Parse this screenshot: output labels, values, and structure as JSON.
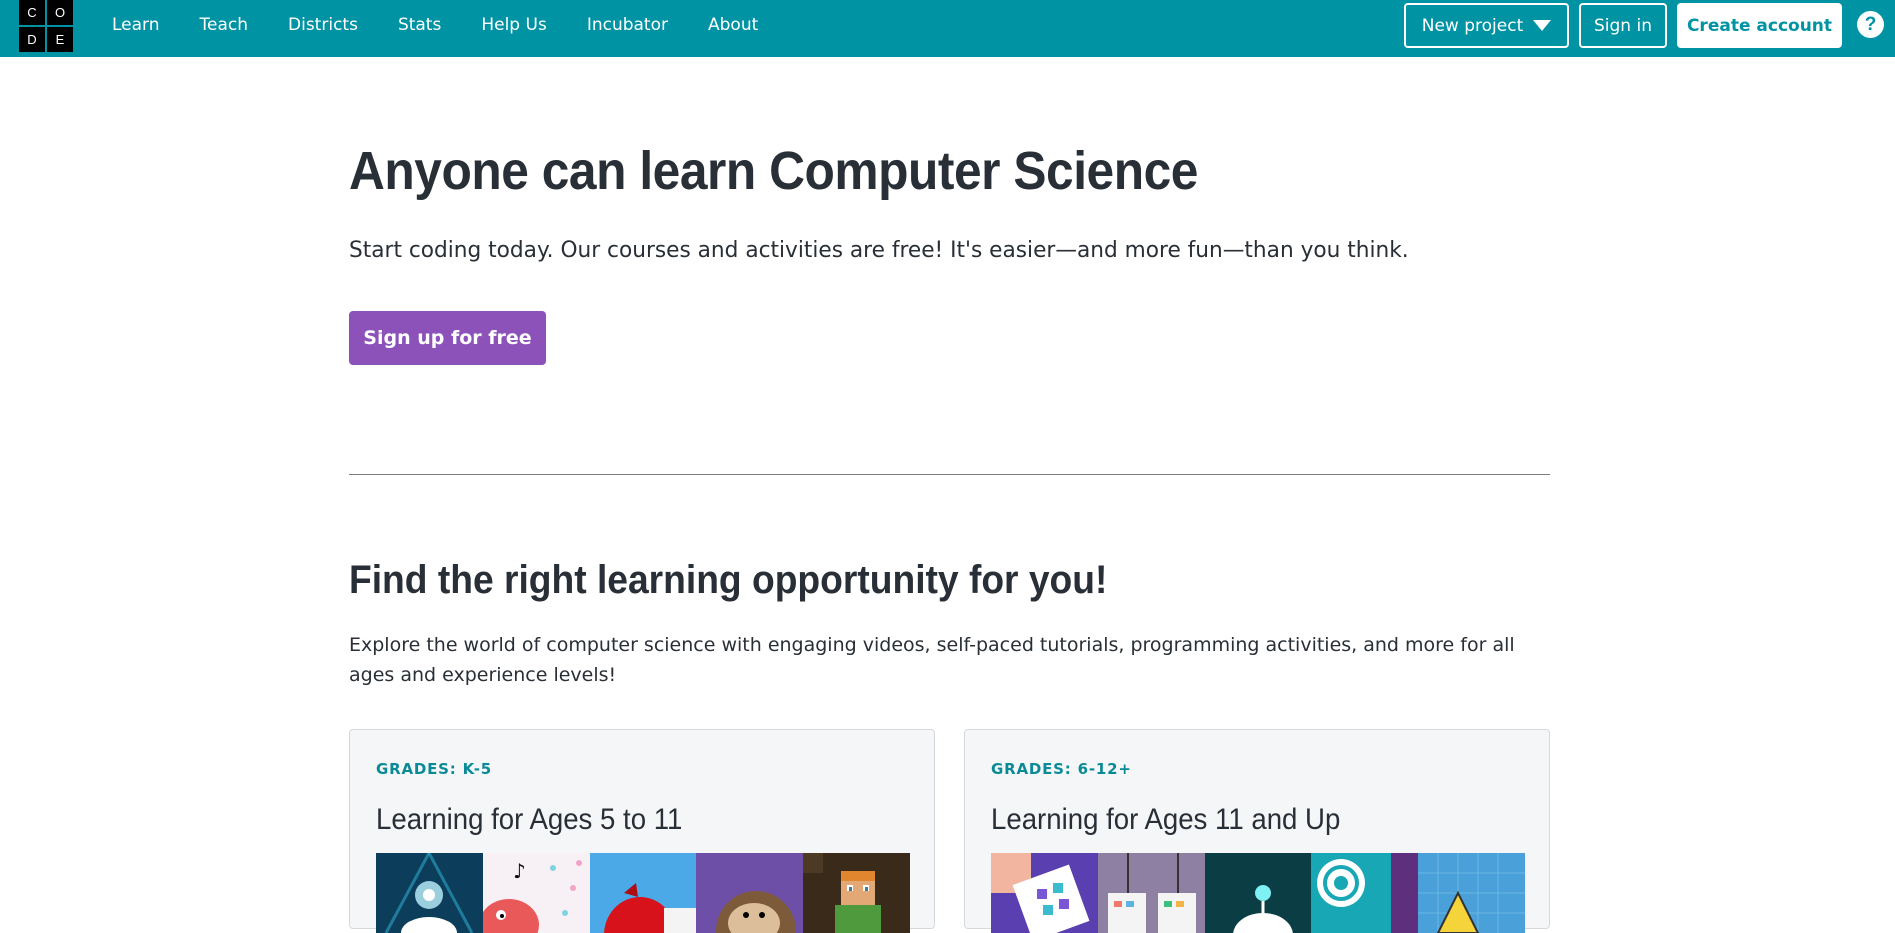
{
  "header": {
    "logo_letters": [
      "C",
      "O",
      "D",
      "E"
    ],
    "nav": [
      "Learn",
      "Teach",
      "Districts",
      "Stats",
      "Help Us",
      "Incubator",
      "About"
    ],
    "new_project_label": "New project",
    "sign_in_label": "Sign in",
    "create_account_label": "Create account",
    "help_label": "?",
    "colors": {
      "bar": "#0093a4",
      "text": "#ffffff"
    }
  },
  "hero": {
    "title": "Anyone can learn Computer Science",
    "subtitle": "Start coding today. Our courses and activities are free! It's easier—and more fun—than you think.",
    "cta_label": "Sign up for free",
    "cta_color": "#8c52ba"
  },
  "find": {
    "title": "Find the right learning opportunity for you!",
    "description": "Explore the world of computer science with engaging videos, self-paced tutorials, programming activities, and more for all ages and experience levels!"
  },
  "cards": [
    {
      "grade": "GRADES: K-5",
      "title": "Learning for Ages 5 to 11",
      "thumbnails": [
        "dance-party-thumbnail",
        "music-birds-thumbnail",
        "angry-bird-thumbnail",
        "monkey-thumbnail",
        "minecraft-thumbnail"
      ]
    },
    {
      "grade": "GRADES: 6-12+",
      "title": "Learning for Ages 11 and Up",
      "thumbnails": [
        "app-lab-thumbnail",
        "game-lab-thumbnail",
        "ai-thumbnail",
        "web-lab-thumbnail",
        "sprite-lab-thumbnail"
      ]
    }
  ]
}
